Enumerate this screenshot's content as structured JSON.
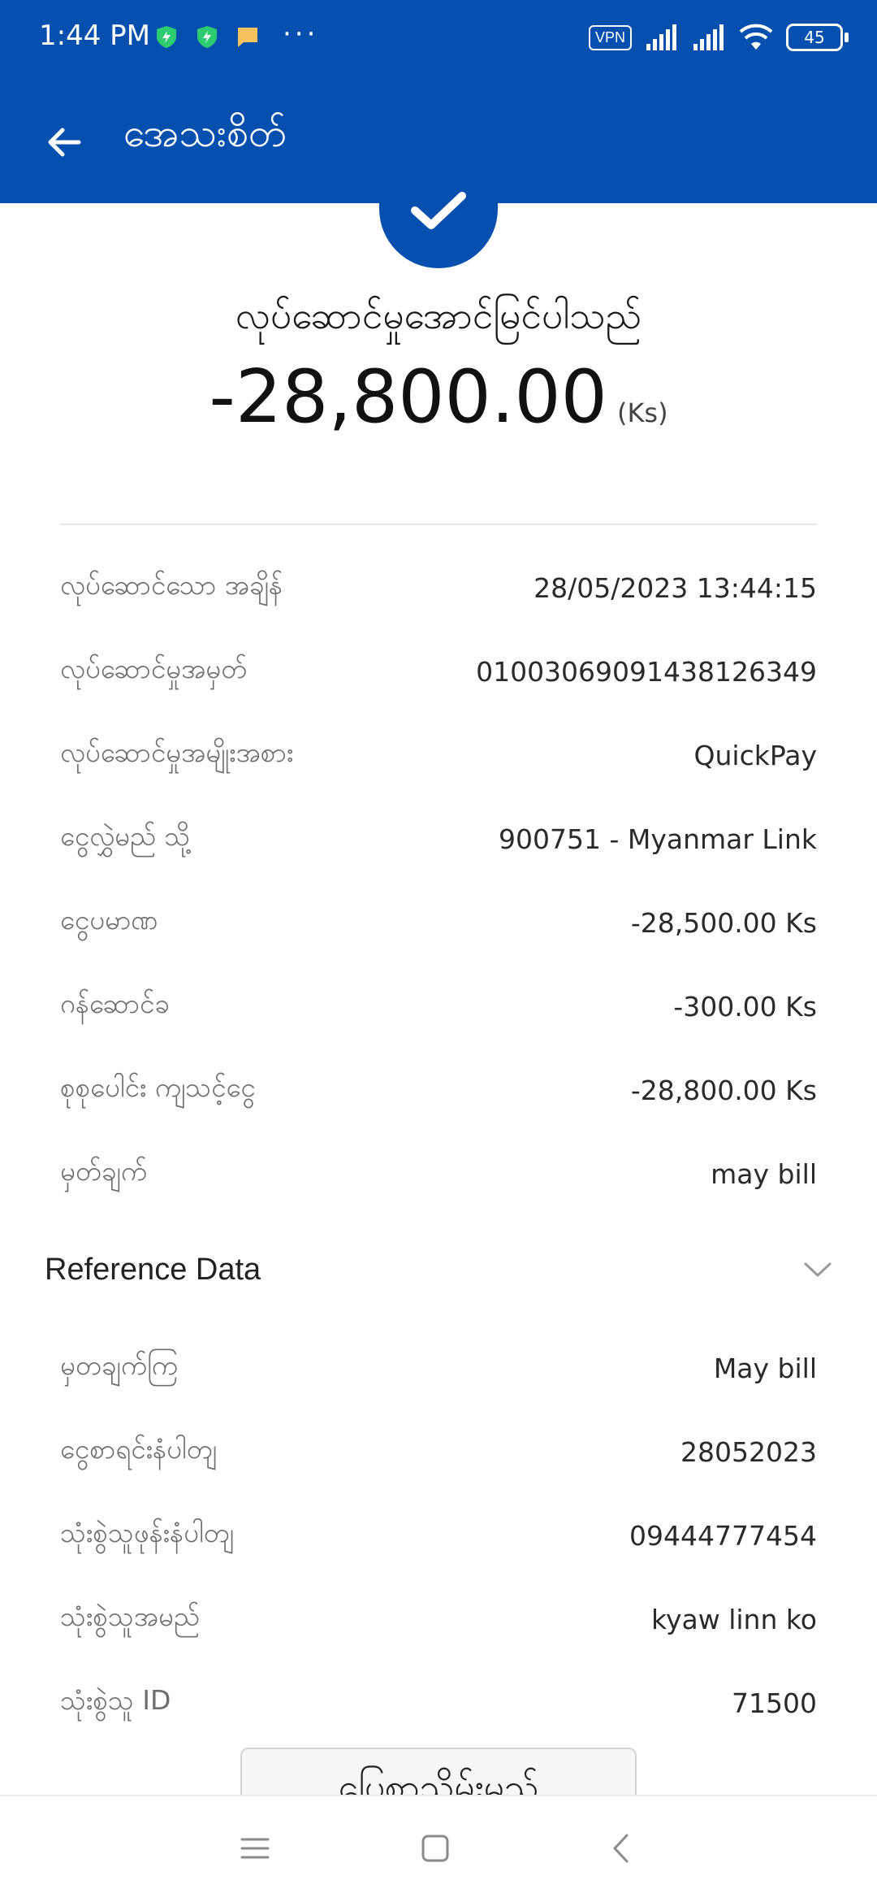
{
  "status_bar": {
    "time": "1:44 PM",
    "dots": "···",
    "vpn": "VPN",
    "battery": "45"
  },
  "appbar": {
    "title": "အေသးစိတ်"
  },
  "result": {
    "status_text": "လုပ်ဆောင်မှုအောင်မြင်ပါသည်",
    "amount": "-28,800.00",
    "currency": "(Ks)"
  },
  "details": [
    {
      "label": "လုပ်ဆောင်သော အချိန်",
      "value": "28/05/2023 13:44:15"
    },
    {
      "label": "လုပ်ဆောင်မှုအမှတ်",
      "value": "01003069091438126349"
    },
    {
      "label": "လုပ်ဆောင်မှုအမျိုးအစား",
      "value": "QuickPay"
    },
    {
      "label": "ငွေလွှဲမည် သို့",
      "value": "900751 - Myanmar Link"
    },
    {
      "label": "ငွေပမာဏ",
      "value": "-28,500.00 Ks"
    },
    {
      "label": "ဂန်ဆောင်ခ",
      "value": "-300.00 Ks"
    },
    {
      "label": "စုစုပေါင်း ကျသင့်ငွေ",
      "value": "-28,800.00 Ks"
    },
    {
      "label": "မှတ်ချက်",
      "value": "may bill"
    }
  ],
  "reference": {
    "title": "Reference Data",
    "items": [
      {
        "label": "မှတချက်ကြ",
        "value": "May bill"
      },
      {
        "label": "ငွေစာရင်းနံပါတျ",
        "value": "28052023"
      },
      {
        "label": "သုံးစွဲသူဖုန်းနံပါတျ",
        "value": "09444777454"
      },
      {
        "label": "သုံးစွဲသူအမည်",
        "value": "kyaw linn ko"
      },
      {
        "label": "သုံးစွဲသူ ID",
        "value": "71500"
      }
    ]
  },
  "print_button": "ပြေစာသိမ်းမည်",
  "colors": {
    "primary": "#0550ae",
    "label": "#6d6d6d"
  }
}
